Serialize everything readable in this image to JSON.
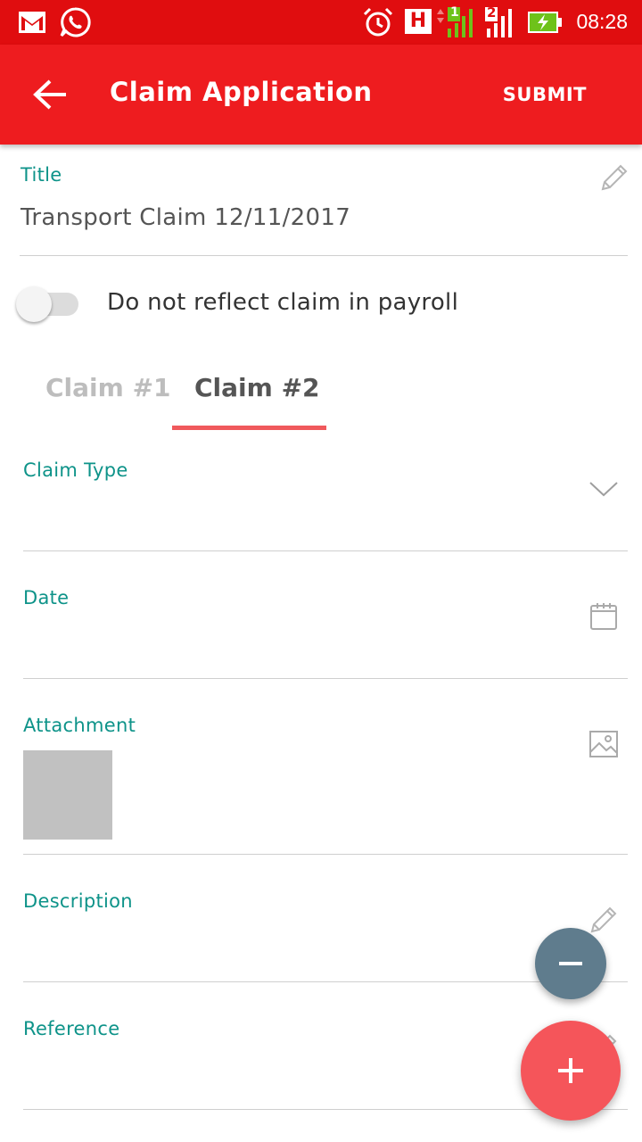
{
  "status_bar": {
    "time": "08:28",
    "icons": [
      "gmail-icon",
      "whatsapp-icon",
      "alarm-icon",
      "h-network-icon",
      "signal-sim1-icon",
      "signal-sim2-icon",
      "battery-charging-icon"
    ],
    "sim1_label": "1",
    "sim2_label": "2",
    "network_label": "H"
  },
  "app_bar": {
    "title": "Claim Application",
    "submit_label": "SUBMIT",
    "background": "#ee1c1f"
  },
  "form": {
    "title_label": "Title",
    "title_value": "Transport Claim 12/11/2017",
    "toggle_label": "Do not reflect claim in payroll",
    "toggle_on": false
  },
  "tabs": [
    {
      "label": "Claim #1",
      "active": false
    },
    {
      "label": "Claim #2",
      "active": true
    }
  ],
  "claim": {
    "claim_type_label": "Claim Type",
    "claim_type_value": "",
    "date_label": "Date",
    "date_value": "",
    "attachment_label": "Attachment",
    "description_label": "Description",
    "description_value": "",
    "reference_label": "Reference",
    "reference_value": ""
  },
  "colors": {
    "accent_teal": "#0e9389",
    "tab_indicator": "#f0595c",
    "fab_add": "#f5555a",
    "fab_remove": "#5f7c8d"
  }
}
